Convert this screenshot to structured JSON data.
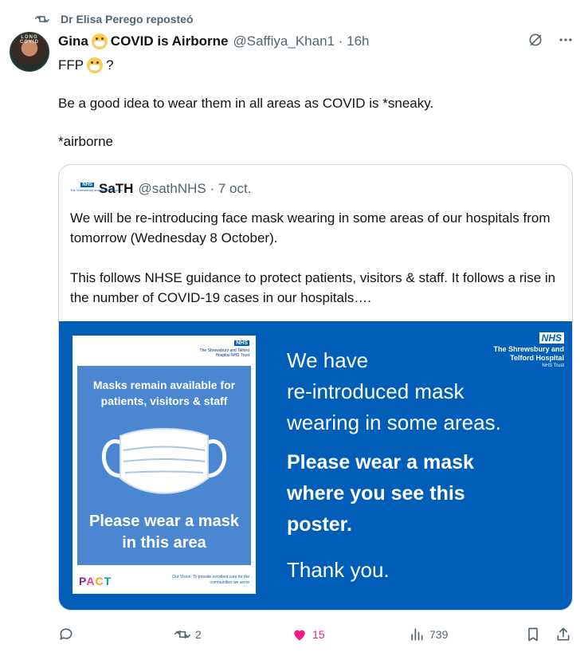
{
  "repost": {
    "label": "Dr Elisa Perego reposteó",
    "icon": "repost-icon"
  },
  "post": {
    "author_name_pre": "Gina",
    "author_name_post": "COVID is Airborne",
    "handle_time": "@Saffiya_Khan1 · 16h",
    "lines": [
      "FFP",
      "?",
      "Be a good idea to wear them in all areas as COVID is *sneaky.",
      "*airborne"
    ],
    "avatar_text": "LONG COVID"
  },
  "quote": {
    "name": "SaTH",
    "handle_time": "@sathNHS · 7 oct.",
    "text_p1": "We will be re-introducing face mask wearing in some areas of our hospitals from tomorrow (Wednesday 8 October).",
    "text_p2": "This follows NHSE guidance to protect patients, visitors & staff.  It follows a rise in the number of COVID-19 cases in our hospitals….",
    "logo_nhs": "NHS",
    "logo_small": "The Shrewsbury and Telford Hospital"
  },
  "image": {
    "poster_nhs": "NHS",
    "poster_trust": "The Shrewsbury and Telford Hospital NHS Trust",
    "poster_top": "Masks remain available for patients, visitors & staff",
    "poster_bottom": "Please wear a mask in this area",
    "poster_pact": "PACT",
    "poster_vision": "Our Vision: To provide excellent care for the communities we serve",
    "logo_nhs": "NHS",
    "logo_name_1": "The Shrewsbury and",
    "logo_name_2": "Telford Hospital",
    "logo_sub": "NHS Trust",
    "text_line1": "We have",
    "text_line2": "re-introduced mask",
    "text_line3": "wearing in some areas.",
    "bold_line1": "Please wear a mask",
    "bold_line2": "where you see this",
    "bold_line3": "poster.",
    "thanks": "Thank you."
  },
  "actions": {
    "reply_count": "",
    "repost_count": "2",
    "like_count": "15",
    "views_count": "739"
  },
  "colors": {
    "nhs_blue": "#005eb8",
    "like_pink": "#f91880",
    "muted": "#536471"
  }
}
